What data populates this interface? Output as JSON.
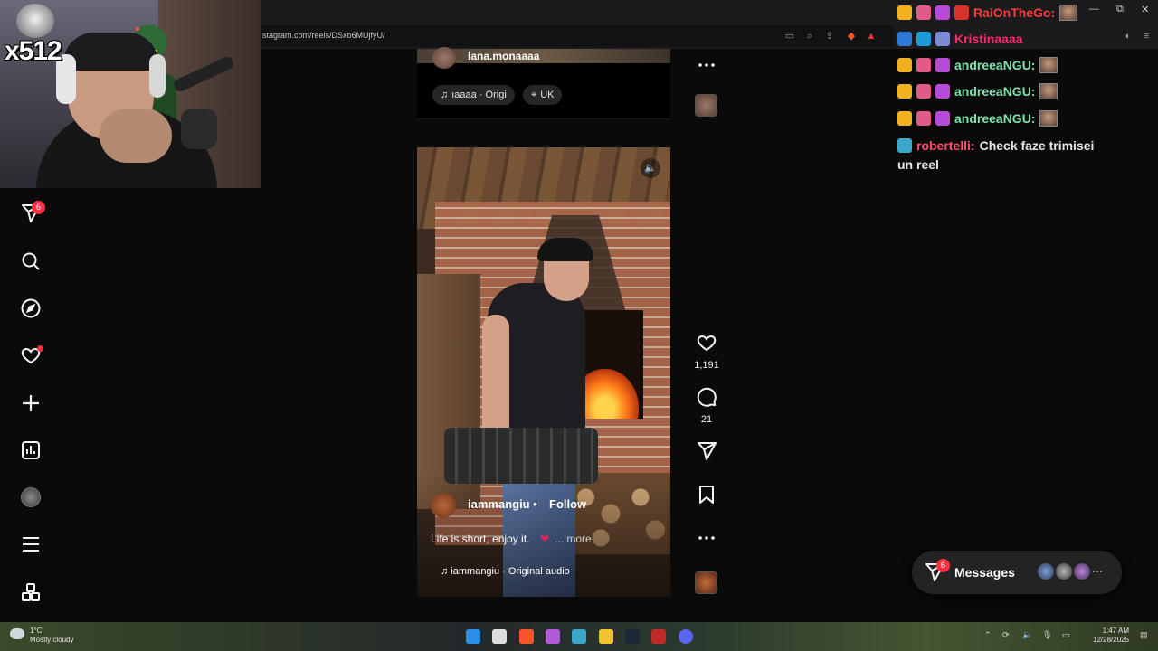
{
  "browser": {
    "url": "stagram.com/reels/DSxo6MUjfyU/"
  },
  "webcam": {
    "overlay_text": "x512"
  },
  "sidebar": {
    "items": [
      {
        "icon": "send-icon",
        "badge": "6"
      },
      {
        "icon": "search-icon"
      },
      {
        "icon": "compass-icon"
      },
      {
        "icon": "heart-icon",
        "dot": true
      },
      {
        "icon": "plus-icon"
      },
      {
        "icon": "dashboard-icon"
      },
      {
        "icon": "profile-avatar"
      },
      {
        "icon": "menu-icon"
      },
      {
        "icon": "apps-icon"
      }
    ]
  },
  "previous_post": {
    "username": "lana.monaaaa",
    "audio_chip": "ıaaaa · Origi",
    "location_chip": "UK"
  },
  "reel": {
    "username": "iammangiu",
    "separator": "•",
    "follow_label": "Follow",
    "caption": "Life is short, enjoy it.",
    "caption_emoji": "❤",
    "more_label": "... more",
    "audio": "iammangiu · Original audio"
  },
  "actions": {
    "likes": "1,191",
    "comments": "21"
  },
  "chat": {
    "lines": [
      {
        "name": "RaiOnTheGo:",
        "name_color": "#ff3b3b"
      },
      {
        "name": "Kristinaaaa",
        "name_color": "#ff2b6a"
      },
      {
        "name": "andreeaNGU:",
        "name_color": "#7fe3b0"
      },
      {
        "name": "andreeaNGU:",
        "name_color": "#7fe3b0"
      },
      {
        "name": "andreeaNGU:",
        "name_color": "#7fe3b0"
      },
      {
        "name": "robertelli:",
        "name_color": "#ff4f6a",
        "message_1": "Check faze trimisei",
        "message_2": "un reel"
      }
    ]
  },
  "messages": {
    "label": "Messages",
    "badge": "6"
  },
  "taskbar": {
    "temperature": "1°C",
    "weather": "Mostly cloudy",
    "time": "1:47 AM",
    "date": "12/28/2025"
  },
  "colors": {
    "notification_red": "#ff3040",
    "brand_accent": "#ffffff"
  }
}
